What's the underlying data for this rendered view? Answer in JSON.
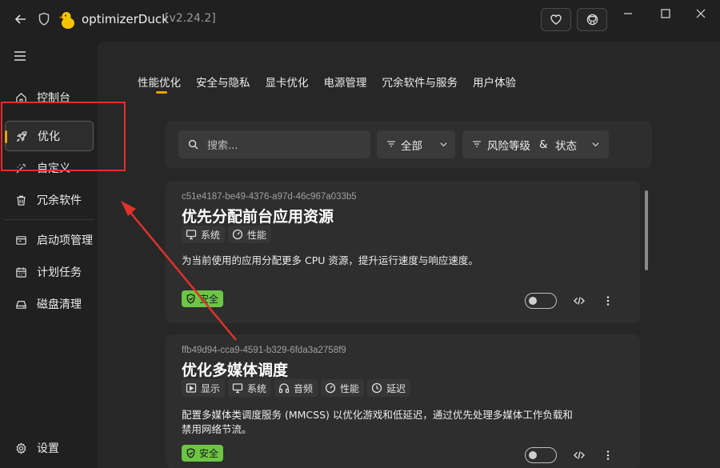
{
  "titlebar": {
    "app_name": "optimizerDuck",
    "version": "[v2.24.2]"
  },
  "sidebar": {
    "items": [
      {
        "label": "控制台",
        "icon": "home-icon"
      },
      {
        "label": "优化",
        "icon": "rocket-icon",
        "active": true
      },
      {
        "label": "自定义",
        "icon": "magic-wand-icon"
      },
      {
        "label": "冗余软件",
        "icon": "trash-icon"
      },
      {
        "label": "启动项管理",
        "icon": "startup-icon"
      },
      {
        "label": "计划任务",
        "icon": "calendar-icon"
      },
      {
        "label": "磁盘清理",
        "icon": "disk-icon"
      }
    ],
    "settings_label": "设置"
  },
  "tabs": [
    "性能优化",
    "安全与隐私",
    "显卡优化",
    "电源管理",
    "冗余软件与服务",
    "用户体验"
  ],
  "filters": {
    "search_placeholder": "搜索...",
    "category": "全部",
    "risk_status_a": "风险等级",
    "risk_status_amp": "&",
    "risk_status_b": "状态"
  },
  "cards": [
    {
      "id": "c51e4187-be49-4376-a97d-46c967a033b5",
      "title": "优先分配前台应用资源",
      "tags": [
        "系统",
        "性能"
      ],
      "description": "为当前使用的应用分配更多 CPU 资源，提升运行速度与响应速度。",
      "risk": "安全",
      "enabled": false
    },
    {
      "id": "ffb49d94-cca9-4591-b329-6fda3a2758f9",
      "title": "优化多媒体调度",
      "tags": [
        "显示",
        "系统",
        "音频",
        "性能",
        "延迟"
      ],
      "description_line1": "配置多媒体类调度服务 (MMCSS) 以优化游戏和低延迟，通过优先处理多媒体工作负载和",
      "description_line2": "禁用网络节流。",
      "risk": "安全",
      "enabled": false
    }
  ],
  "colors": {
    "accent": "#e8a200",
    "safe_badge": "#6cc644",
    "annotation_red": "#e1322a"
  }
}
